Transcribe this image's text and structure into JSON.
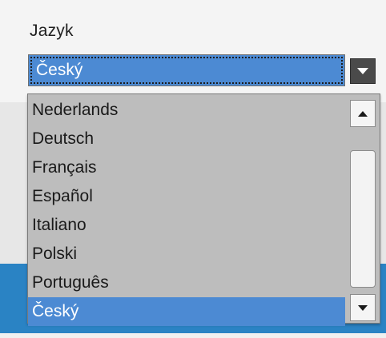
{
  "language_setting": {
    "label": "Jazyk",
    "selected_value": "Český"
  },
  "dropdown": {
    "options": [
      "Nederlands",
      "Deutsch",
      "Français",
      "Español",
      "Italiano",
      "Polski",
      "Português",
      "Český"
    ],
    "selected_index": 7
  },
  "icons": {
    "combo_button": "chevron-down-icon",
    "scroll_up": "arrow-up-icon",
    "scroll_down": "arrow-down-icon"
  },
  "colors": {
    "selection": "#4c8ad3",
    "accent_band": "#2a83c4"
  }
}
